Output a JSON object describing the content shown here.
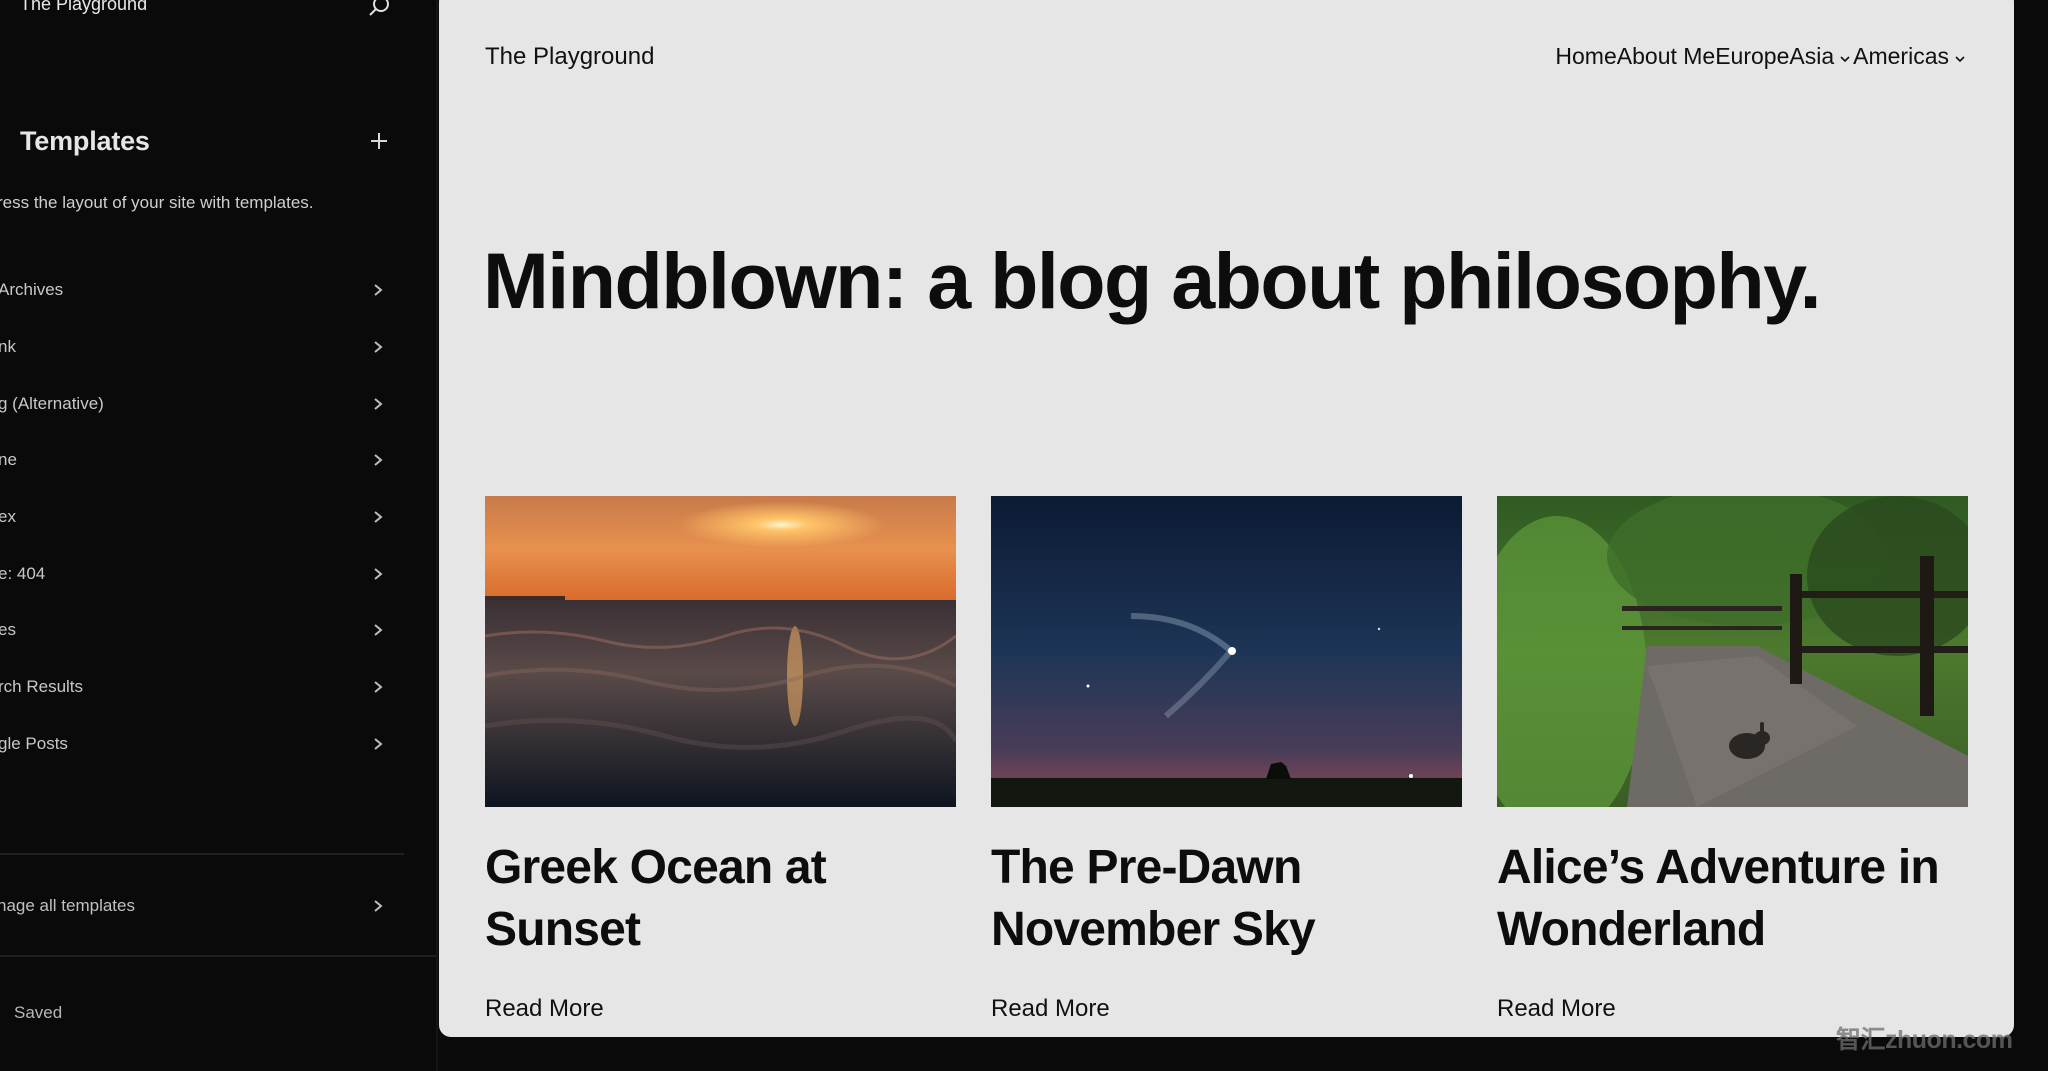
{
  "sidebar": {
    "site_name": "The Playground",
    "search_icon": "search-icon",
    "title": "Templates",
    "add_icon": "plus-icon",
    "description": "ress the layout of your site with templates.",
    "items": [
      {
        "label": "Archives"
      },
      {
        "label": "nk"
      },
      {
        "label": "g (Alternative)"
      },
      {
        "label": "ne"
      },
      {
        "label": "ex"
      },
      {
        "label": "e: 404"
      },
      {
        "label": "es"
      },
      {
        "label": "rch Results"
      },
      {
        "label": "gle Posts"
      }
    ],
    "manage_label": "nage all templates",
    "status": "Saved"
  },
  "preview": {
    "site_title": "The Playground",
    "nav": [
      {
        "label": "Home",
        "has_submenu": false
      },
      {
        "label": "About Me",
        "has_submenu": false
      },
      {
        "label": "Europe",
        "has_submenu": false
      },
      {
        "label": "Asia",
        "has_submenu": true
      },
      {
        "label": "Americas",
        "has_submenu": true
      }
    ],
    "hero_heading": "Mindblown: a blog about philosophy.",
    "posts": [
      {
        "title": "Greek Ocean at Sunset",
        "image": "ocean-sunset-photo",
        "read_more": "Read More"
      },
      {
        "title": "The Pre-Dawn November Sky",
        "image": "night-sky-rocket-trail-photo",
        "read_more": "Read More"
      },
      {
        "title": "Alice’s Adventure in Wonderland",
        "image": "forest-path-rabbit-photo",
        "read_more": "Read More"
      }
    ]
  },
  "watermark": "智汇zhuon.com",
  "colors": {
    "sidebar_bg": "#0a0a0a",
    "canvas_bg": "#e6e6e6",
    "text_dark": "#111111",
    "text_light": "#e6e6e6"
  }
}
